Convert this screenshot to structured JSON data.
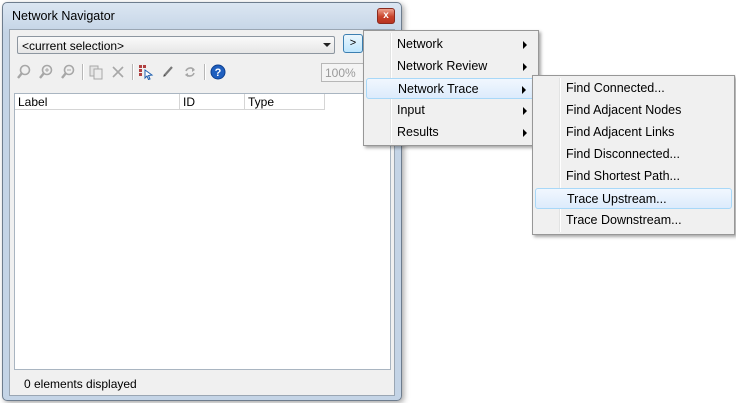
{
  "window": {
    "title": "Network Navigator",
    "close_glyph": "x",
    "selection": "<current selection>",
    "go_button": ">",
    "zoom": "100%",
    "columns": [
      "Label",
      "ID",
      "Type"
    ],
    "status": "0 elements displayed",
    "toolbar_icons": [
      "zoom-extent-icon",
      "zoom-in-icon",
      "zoom-out-icon",
      "copy-icon",
      "delete-icon",
      "select-icon",
      "edit-icon",
      "refresh-icon",
      "help-icon"
    ]
  },
  "menu": {
    "items": [
      {
        "label": "Network"
      },
      {
        "label": "Network Review"
      },
      {
        "label": "Network Trace"
      },
      {
        "label": "Input"
      },
      {
        "label": "Results"
      }
    ],
    "highlighted": "Network Trace"
  },
  "submenu": {
    "items": [
      {
        "label": "Find Connected..."
      },
      {
        "label": "Find Adjacent Nodes"
      },
      {
        "label": "Find Adjacent Links"
      },
      {
        "label": "Find Disconnected..."
      },
      {
        "label": "Find Shortest Path..."
      },
      {
        "label": "Trace Upstream..."
      },
      {
        "label": "Trace Downstream..."
      }
    ],
    "highlighted": "Trace Upstream..."
  },
  "colors": {
    "highlight_border": "#a8d8f8",
    "close_red": "#c8432b",
    "help_blue": "#1f5fbf"
  }
}
